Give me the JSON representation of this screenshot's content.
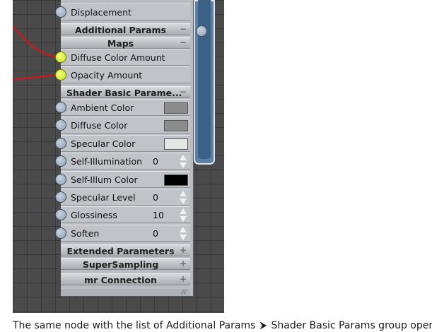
{
  "node": {
    "rows_top": {
      "displacement": "Displacement"
    },
    "headers": {
      "additional_params": {
        "label": "Additional Params",
        "toggle": "−"
      },
      "maps": {
        "label": "Maps",
        "toggle": "−"
      },
      "shader_basic": {
        "label": "Shader Basic Parame...",
        "toggle": "−"
      },
      "extended": {
        "label": "Extended Parameters",
        "toggle": "+"
      },
      "supersampling": {
        "label": "SuperSampling",
        "toggle": "+"
      },
      "mr_connection": {
        "label": "mr Connection",
        "toggle": "+"
      }
    },
    "maps_rows": {
      "diffuse_color_amount": "Diffuse Color Amount",
      "opacity_amount": "Opacity Amount"
    },
    "shader_rows": [
      {
        "label": "Ambient Color",
        "swatch": "#8c8c8c"
      },
      {
        "label": "Diffuse Color",
        "swatch": "#8c8c8c"
      },
      {
        "label": "Specular Color",
        "swatch": "#e6e6e6"
      },
      {
        "label": "Self-Illumination",
        "value": "0"
      },
      {
        "label": "Self-Illum Color",
        "swatch": "#000000"
      },
      {
        "label": "Specular Level",
        "value": "0"
      },
      {
        "label": "Glossiness",
        "value": "10"
      },
      {
        "label": "Soften",
        "value": "0"
      }
    ]
  },
  "colors": {
    "wire": "#e01010",
    "port_active": "#d4ec2a",
    "blue_node": "#5d7fa4"
  },
  "caption": {
    "part1": "The same node with the list of Additional Params",
    "arrow": "⮞",
    "part2": "Shader Basic Params group opened"
  }
}
